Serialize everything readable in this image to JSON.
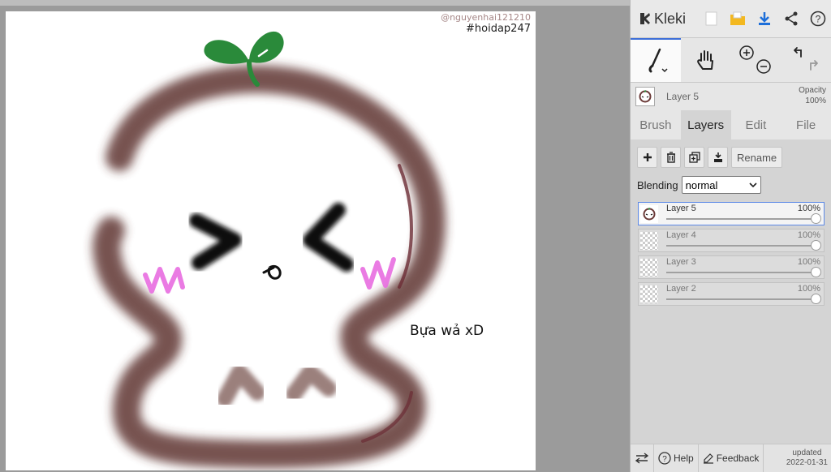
{
  "canvas": {
    "watermark_user": "@nguyenhai121210",
    "watermark_tag": "#hoidap247",
    "caption": "Bựa wả xD"
  },
  "toolbar": {
    "app_name": "Kleki"
  },
  "layer_info": {
    "current_layer": "Layer 5",
    "opacity_label": "Opacity",
    "opacity_value": "100%"
  },
  "tabs": [
    {
      "label": "Brush",
      "active": false
    },
    {
      "label": "Layers",
      "active": true
    },
    {
      "label": "Edit",
      "active": false
    },
    {
      "label": "File",
      "active": false
    }
  ],
  "layers_panel": {
    "rename_label": "Rename",
    "blending_label": "Blending",
    "blending_value": "normal",
    "layers": [
      {
        "name": "Layer 5",
        "opacity": "100%",
        "selected": true
      },
      {
        "name": "Layer 4",
        "opacity": "100%",
        "selected": false
      },
      {
        "name": "Layer 3",
        "opacity": "100%",
        "selected": false
      },
      {
        "name": "Layer 2",
        "opacity": "100%",
        "selected": false
      }
    ]
  },
  "footer": {
    "help_label": "Help",
    "feedback_label": "Feedback",
    "updated_label": "updated",
    "updated_date": "2022-01-31"
  },
  "colors": {
    "accent": "#3d6fd8",
    "stroke_brown": "#5a2f2c",
    "leaf_green": "#2a8a3a",
    "blush_pink": "#e86de0"
  }
}
